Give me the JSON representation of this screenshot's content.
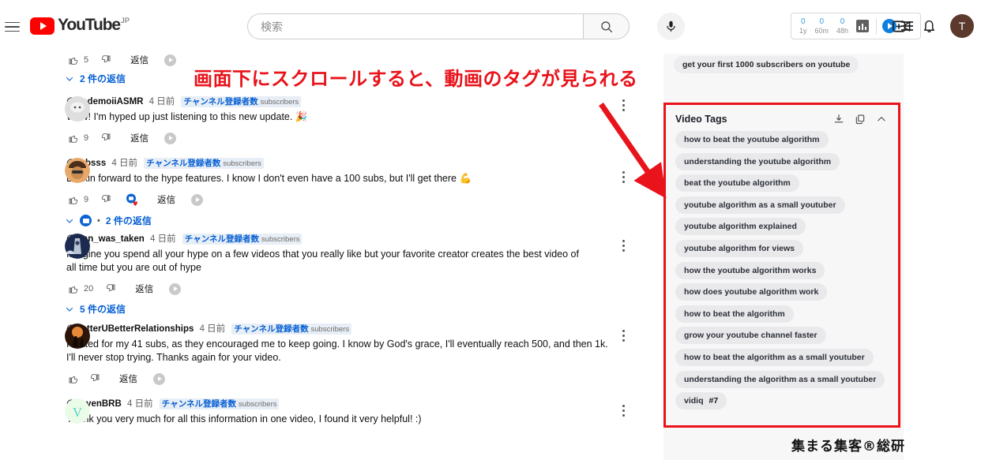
{
  "header": {
    "menu_icon": "hamburger-icon",
    "logo_text": "YouTube",
    "logo_country": "JP",
    "search_placeholder": "検索",
    "search_value": "",
    "search_icon": "search-icon",
    "mic_icon": "microphone-icon",
    "create_icon": "create-video-icon",
    "bell_icon": "notifications-bell-icon",
    "avatar_letter": "T",
    "vidiq": {
      "stats": [
        {
          "num": "0",
          "label": "1y"
        },
        {
          "num": "0",
          "label": "60m"
        },
        {
          "num": "0",
          "label": "48h"
        }
      ],
      "chart_icon": "bar-chart-icon",
      "logo_icon": "vidiq-logo-icon",
      "menu_icon": "vidiq-menu-icon"
    }
  },
  "comments": [
    {
      "author": "",
      "time": "",
      "badge": "",
      "badge_sub": "",
      "text": "",
      "likes": "5",
      "reply_label": "返信",
      "replies_label": "2 件の返信",
      "partial": true
    },
    {
      "author": "@HodemoiiASMR",
      "time": "4 日前",
      "badge": "チャンネル登録者数",
      "badge_sub": "subscribers",
      "text": "Wow! I'm hyped up just listening to this new update. 🎉",
      "likes": "9",
      "reply_label": "返信",
      "replies_label": ""
    },
    {
      "author": "@Jebsss",
      "time": "4 日前",
      "badge": "チャンネル登録者数",
      "badge_sub": "subscribers",
      "text": "Lookin forward to the hype features. I know I don't even have a 100 subs, but I'll get there 💪",
      "likes": "9",
      "reply_label": "返信",
      "replies_label": "2 件の返信",
      "has_heart": true
    },
    {
      "author": "@ivan_was_taken",
      "time": "4 日前",
      "badge": "チャンネル登録者数",
      "badge_sub": "subscribers",
      "text": "Imagine you spend all your hype on a few videos that you really like but your favorite creator creates the best video of all time but you are out of hype",
      "likes": "20",
      "reply_label": "返信",
      "replies_label": "5 件の返信"
    },
    {
      "author": "@BetterUBetterRelationships",
      "time": "4 日前",
      "badge": "チャンネル登録者数",
      "badge_sub": "subscribers",
      "text": "I elated for my 41 subs, as they encouraged me to keep going. I know by God's grace, I'll eventually reach 500, and then 1k. I'll never stop trying. Thanks again for your video.",
      "likes": "",
      "reply_label": "返信",
      "replies_label": ""
    },
    {
      "author": "@VovenBRB",
      "time": "4 日前",
      "badge": "チャンネル登録者数",
      "badge_sub": "subscribers",
      "text": "Thank you very much for all this information in one video, I found it very helpful! :)",
      "likes": "",
      "reply_label": "",
      "replies_label": ""
    }
  ],
  "right_panel": {
    "top_chip": "get your first 1000 subscribers on youtube",
    "tags_card": {
      "title": "Video Tags",
      "download_icon": "download-icon",
      "copy_icon": "copy-icon",
      "collapse_icon": "chevron-up-icon",
      "tags": [
        {
          "label": "how to beat the youtube algorithm",
          "rank": ""
        },
        {
          "label": "understanding the youtube algorithm",
          "rank": ""
        },
        {
          "label": "beat the youtube algorithm",
          "rank": ""
        },
        {
          "label": "youtube algorithm as a small youtuber",
          "rank": ""
        },
        {
          "label": "youtube algorithm explained",
          "rank": ""
        },
        {
          "label": "youtube algorithm for views",
          "rank": ""
        },
        {
          "label": "how the youtube algorithm works",
          "rank": ""
        },
        {
          "label": "how does youtube algorithm work",
          "rank": ""
        },
        {
          "label": "how to beat the algorithm",
          "rank": ""
        },
        {
          "label": "grow your youtube channel faster",
          "rank": ""
        },
        {
          "label": "how to beat the algorithm as a small youtuber",
          "rank": ""
        },
        {
          "label": "understanding the algorithm as a small youtuber",
          "rank": ""
        },
        {
          "label": "vidiq",
          "rank": "#7"
        }
      ]
    }
  },
  "annotations": {
    "callout_text": "画面下にスクロールすると、動画のタグが見られる",
    "arrow_icon": "red-arrow-icon",
    "watermark": "集まる集客®総研",
    "accent_red": "#e8131b"
  }
}
